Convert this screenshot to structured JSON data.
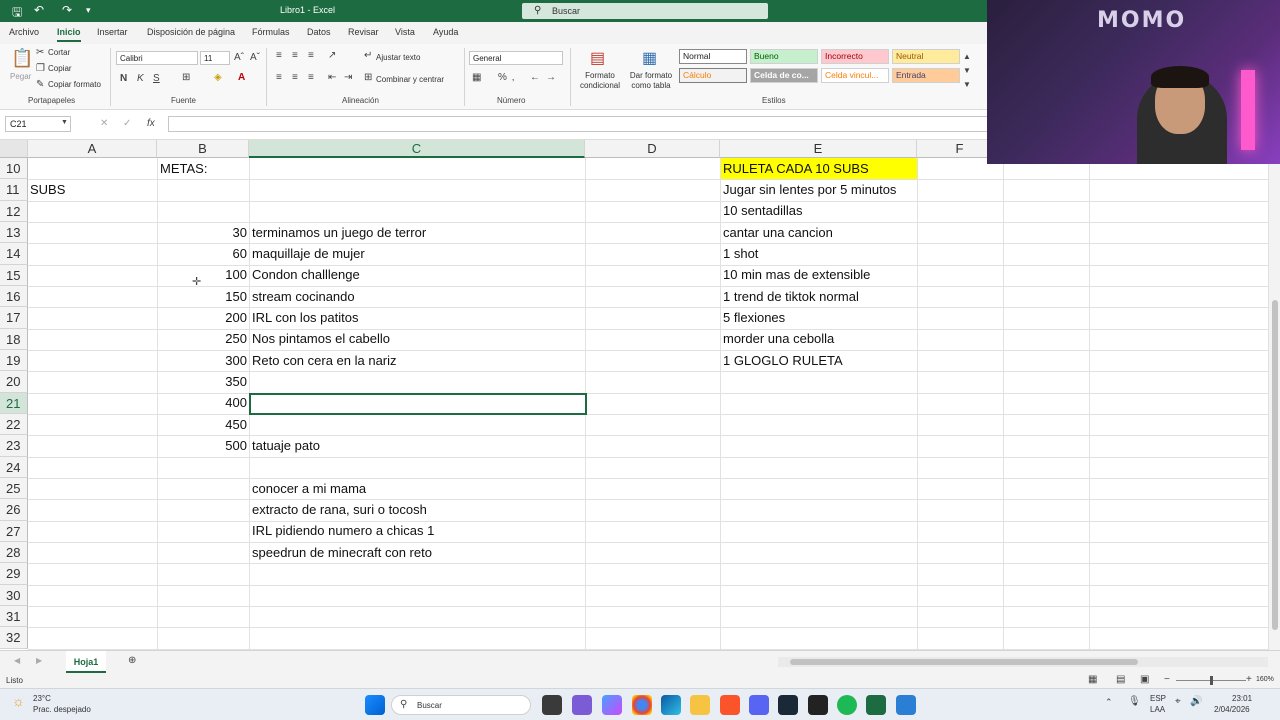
{
  "window": {
    "title": "Libro1 - Excel",
    "search": "Buscar"
  },
  "ribbon": {
    "tabs": [
      "Archivo",
      "Inicio",
      "Insertar",
      "Disposición de página",
      "Fórmulas",
      "Datos",
      "Revisar",
      "Vista",
      "Ayuda"
    ],
    "clipboard": {
      "paste": "Pegar",
      "cut": "Cortar",
      "copy": "Copiar",
      "format_painter": "Copiar formato",
      "group": "Portapapeles"
    },
    "font": {
      "name": "Calibri",
      "size": "11",
      "bold": "N",
      "italic": "K",
      "underline": "S",
      "group": "Fuente"
    },
    "alignment": {
      "wrap": "Ajustar texto",
      "merge": "Combinar y centrar",
      "group": "Alineación"
    },
    "number": {
      "format": "General",
      "group": "Número"
    },
    "styles": {
      "conditional": "Formato condicional",
      "table": "Dar formato como tabla",
      "group": "Estilos",
      "cells": [
        "Normal",
        "Bueno",
        "Incorrecto",
        "Neutral",
        "Cálculo",
        "Celda de co...",
        "Celda vincul...",
        "Entrada"
      ]
    }
  },
  "formula_bar": {
    "cell_ref": "C21",
    "fx": "fx",
    "value": ""
  },
  "columns": [
    "A",
    "B",
    "C",
    "D",
    "E",
    "F"
  ],
  "rows": [
    "10",
    "11",
    "12",
    "13",
    "14",
    "15",
    "16",
    "17",
    "18",
    "19",
    "20",
    "21",
    "22",
    "23",
    "24",
    "25",
    "26",
    "27",
    "28",
    "29",
    "30",
    "31",
    "32"
  ],
  "cells": {
    "B10": "METAS:",
    "A11": "SUBS",
    "B13": "30",
    "C13": "terminamos un juego de terror",
    "B14": "60",
    "C14": "maquillaje de mujer",
    "B15": "100",
    "C15": "Condon challlenge",
    "B16": "150",
    "C16": "stream cocinando",
    "B17": "200",
    "C17": "IRL con los patitos",
    "B18": "250",
    "C18": "Nos pintamos el cabello",
    "B19": "300",
    "C19": "Reto con cera en la nariz",
    "B20": "350",
    "B21": "400",
    "B22": "450",
    "B23": "500",
    "C23": "tatuaje pato",
    "C25": "conocer a mi mama",
    "C26": "extracto de rana, suri o tocosh",
    "C27": "IRL pidiendo numero a chicas 1",
    "C28": "speedrun de minecraft con reto",
    "E10": "RULETA CADA 10 SUBS",
    "E11": "Jugar sin lentes por 5 minutos",
    "E12": "10 sentadillas",
    "E13": "cantar una cancion",
    "E14": "1 shot",
    "E15": "10 min mas de extensible",
    "E16": "1 trend de tiktok normal",
    "E17": "5 flexiones",
    "E18": "morder una cebolla",
    "E19": "1 GLOGLO RULETA"
  },
  "sheet_tab": "Hoja1",
  "status": {
    "mode": "Listo",
    "zoom": "160%"
  },
  "taskbar": {
    "weather_temp": "23°C",
    "weather_desc": "Prac. despejado",
    "search": "Buscar",
    "lang": "ESP",
    "lang2": "LAA",
    "time": "23:01",
    "date": "2/04/2026"
  },
  "webcam": {
    "sign": "MOMO"
  },
  "colors": {
    "excel_green": "#1d6b41",
    "highlight": "#ffff00"
  }
}
